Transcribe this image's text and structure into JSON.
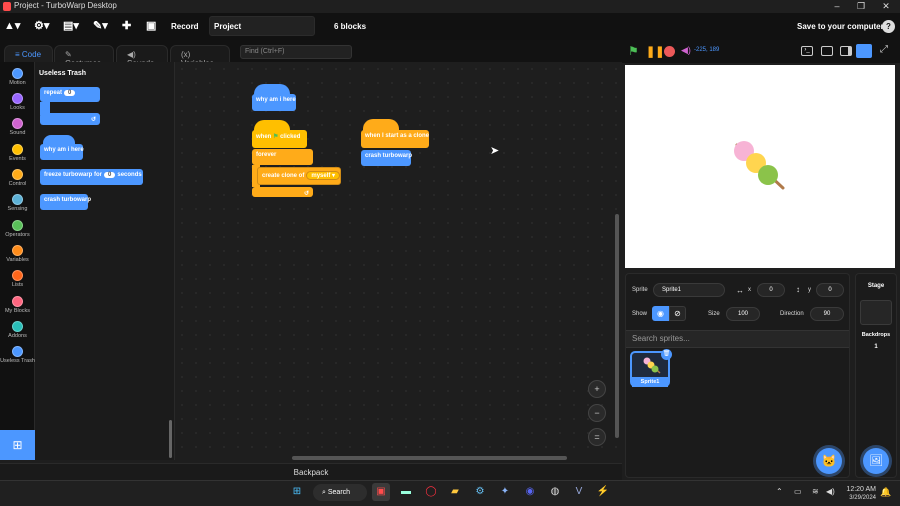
{
  "window": {
    "title": "Project - TurboWarp Desktop",
    "minimize": "–",
    "maximize": "❐",
    "close": "✕"
  },
  "menubar": {
    "record_label": "Record",
    "project_title": "Project",
    "block_count": "6 blocks",
    "save_label": "Save to your computer",
    "help": "?"
  },
  "tabs": [
    {
      "label": "Code"
    },
    {
      "label": "Costumes"
    },
    {
      "label": "Sounds"
    },
    {
      "label": "Variables"
    }
  ],
  "find": {
    "placeholder": "Find (Ctrl+F)"
  },
  "categories": [
    {
      "label": "Motion",
      "color": "#4c97ff"
    },
    {
      "label": "Looks",
      "color": "#9966ff"
    },
    {
      "label": "Sound",
      "color": "#cf63cf"
    },
    {
      "label": "Events",
      "color": "#ffbf00"
    },
    {
      "label": "Control",
      "color": "#ffab19"
    },
    {
      "label": "Sensing",
      "color": "#5cb1d6"
    },
    {
      "label": "Operators",
      "color": "#59c059"
    },
    {
      "label": "Variables",
      "color": "#ff8c1a"
    },
    {
      "label": "Lists",
      "color": "#ff661a"
    },
    {
      "label": "My Blocks",
      "color": "#ff6680"
    },
    {
      "label": "Addons",
      "color": "#29beb8"
    },
    {
      "label": "Useless Trash",
      "color": "#4c97ff"
    }
  ],
  "palette": {
    "title": "Useless Trash",
    "repeat_label": "repeat",
    "repeat_value": "0",
    "why_label": "why am i here",
    "freeze_label": "freeze turbowarp for",
    "freeze_value": "0",
    "freeze_unit": "seconds",
    "crash_label": "crash turbowarp"
  },
  "workspace": {
    "why_label": "why am i here",
    "flag_when": "when",
    "flag_clicked": "clicked",
    "forever_label": "forever",
    "clone_label": "create clone of",
    "clone_target": "myself",
    "clone_hat_label": "when I start as a clone",
    "crash_label": "crash turbowarp",
    "zoom_in": "+",
    "zoom_out": "−",
    "zoom_reset": "="
  },
  "backpack": {
    "label": "Backpack"
  },
  "stage_header": {
    "coords": "-225, 189"
  },
  "sprite_info": {
    "sprite_label": "Sprite",
    "sprite_name": "Sprite1",
    "x_label": "x",
    "x_value": "0",
    "y_label": "y",
    "y_value": "0",
    "show_label": "Show",
    "size_label": "Size",
    "size_value": "100",
    "direction_label": "Direction",
    "direction_value": "90",
    "search_placeholder": "Search sprites...",
    "thumb_name": "Sprite1"
  },
  "stage_panel": {
    "title": "Stage",
    "backdrops_label": "Backdrops",
    "backdrops_count": "1"
  },
  "taskbar": {
    "search_label": "Search",
    "time": "12:20 AM",
    "date": "3/29/2024"
  }
}
